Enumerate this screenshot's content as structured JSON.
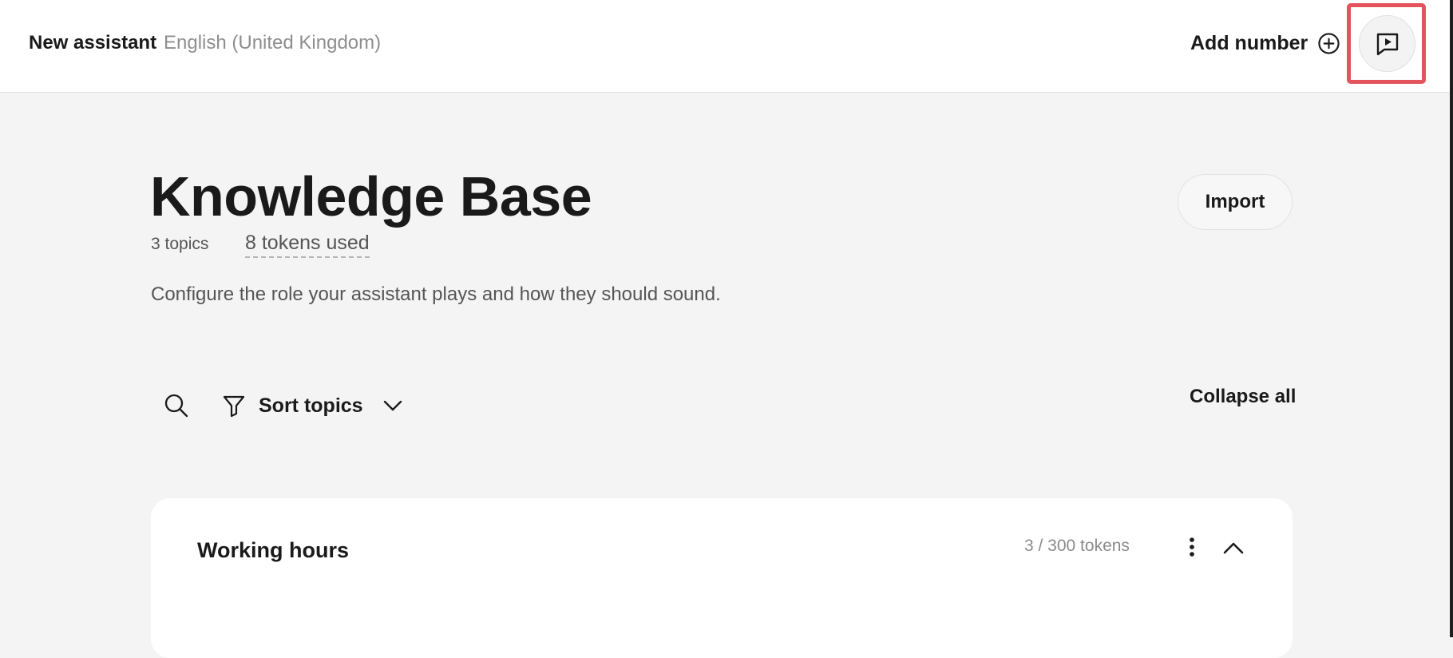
{
  "header": {
    "assistant_name": "New assistant",
    "locale": "English (United Kingdom)",
    "add_number_label": "Add number",
    "add_number_icon": "plus-circle-icon",
    "preview_icon": "chat-play-icon",
    "highlight_color": "#e5545c"
  },
  "knowledge_base": {
    "title": "Knowledge Base",
    "topic_count": "3 topics",
    "tokens_used": "8 tokens used",
    "description": "Configure the role your assistant plays and how they should sound.",
    "import_label": "Import"
  },
  "toolbar": {
    "search_icon": "search-icon",
    "sort_icon": "filter-icon",
    "sort_label": "Sort topics",
    "sort_chevron": "chevron-down-icon",
    "collapse_all_label": "Collapse all"
  },
  "topics": [
    {
      "title": "Working hours",
      "tokens": "3 / 300 tokens",
      "menu_icon": "more-vertical-icon",
      "toggle_icon": "chevron-up-icon"
    }
  ]
}
